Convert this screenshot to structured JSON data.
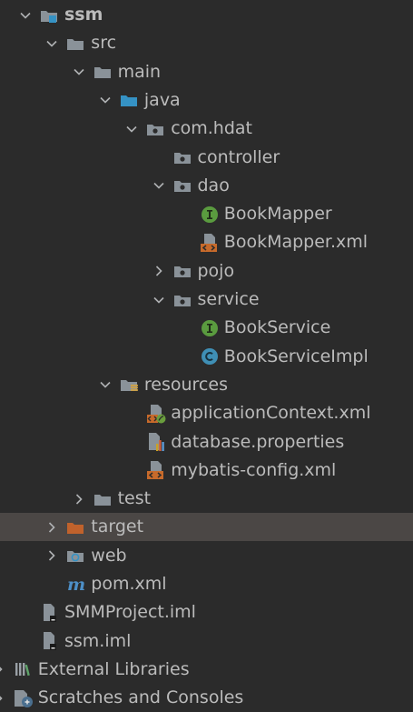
{
  "colors": {
    "background": "#2b2b2b",
    "selected_row": "#4b4745",
    "text": "#bbbbbb",
    "folder": "#8a9299",
    "source_folder": "#3592c4",
    "excluded_folder": "#c0622c",
    "interface_badge": "#5a9b3f",
    "class_badge": "#3f8fb5",
    "xml_badge": "#c76a2b",
    "maven": "#4d8fc7"
  },
  "tree": {
    "items": [
      {
        "label": "ssm",
        "depth": 0,
        "arrow": "expanded",
        "icon": "module-folder-icon",
        "bold": true
      },
      {
        "label": "src",
        "depth": 1,
        "arrow": "expanded",
        "icon": "folder-icon"
      },
      {
        "label": "main",
        "depth": 2,
        "arrow": "expanded",
        "icon": "folder-icon"
      },
      {
        "label": "java",
        "depth": 3,
        "arrow": "expanded",
        "icon": "source-folder-icon"
      },
      {
        "label": "com.hdat",
        "depth": 4,
        "arrow": "expanded",
        "icon": "package-icon"
      },
      {
        "label": "controller",
        "depth": 5,
        "arrow": "none",
        "icon": "package-icon"
      },
      {
        "label": "dao",
        "depth": 5,
        "arrow": "expanded",
        "icon": "package-icon"
      },
      {
        "label": "BookMapper",
        "depth": 6,
        "arrow": "none",
        "icon": "interface-icon"
      },
      {
        "label": "BookMapper.xml",
        "depth": 6,
        "arrow": "none",
        "icon": "xml-file-icon"
      },
      {
        "label": "pojo",
        "depth": 5,
        "arrow": "collapsed",
        "icon": "package-icon"
      },
      {
        "label": "service",
        "depth": 5,
        "arrow": "expanded",
        "icon": "package-icon"
      },
      {
        "label": "BookService",
        "depth": 6,
        "arrow": "none",
        "icon": "interface-icon"
      },
      {
        "label": "BookServiceImpl",
        "depth": 6,
        "arrow": "none",
        "icon": "class-icon"
      },
      {
        "label": "resources",
        "depth": 3,
        "arrow": "expanded",
        "icon": "resources-folder-icon"
      },
      {
        "label": "applicationContext.xml",
        "depth": 4,
        "arrow": "none",
        "icon": "spring-xml-icon"
      },
      {
        "label": "database.properties",
        "depth": 4,
        "arrow": "none",
        "icon": "properties-file-icon"
      },
      {
        "label": "mybatis-config.xml",
        "depth": 4,
        "arrow": "none",
        "icon": "xml-file-icon"
      },
      {
        "label": "test",
        "depth": 2,
        "arrow": "collapsed",
        "icon": "folder-icon"
      },
      {
        "label": "target",
        "depth": 1,
        "arrow": "collapsed",
        "icon": "excluded-folder-icon",
        "selected": true
      },
      {
        "label": "web",
        "depth": 1,
        "arrow": "collapsed",
        "icon": "web-folder-icon"
      },
      {
        "label": "pom.xml",
        "depth": 1,
        "arrow": "none",
        "icon": "maven-icon"
      },
      {
        "label": "SMMProject.iml",
        "depth": 0,
        "arrow": "none",
        "icon": "iml-file-icon"
      },
      {
        "label": "ssm.iml",
        "depth": 0,
        "arrow": "none",
        "icon": "iml-file-icon"
      },
      {
        "label": "External Libraries",
        "depth": -1,
        "arrow": "collapsed",
        "icon": "libraries-icon"
      },
      {
        "label": "Scratches and Consoles",
        "depth": -1,
        "arrow": "collapsed",
        "icon": "scratches-icon"
      }
    ]
  }
}
